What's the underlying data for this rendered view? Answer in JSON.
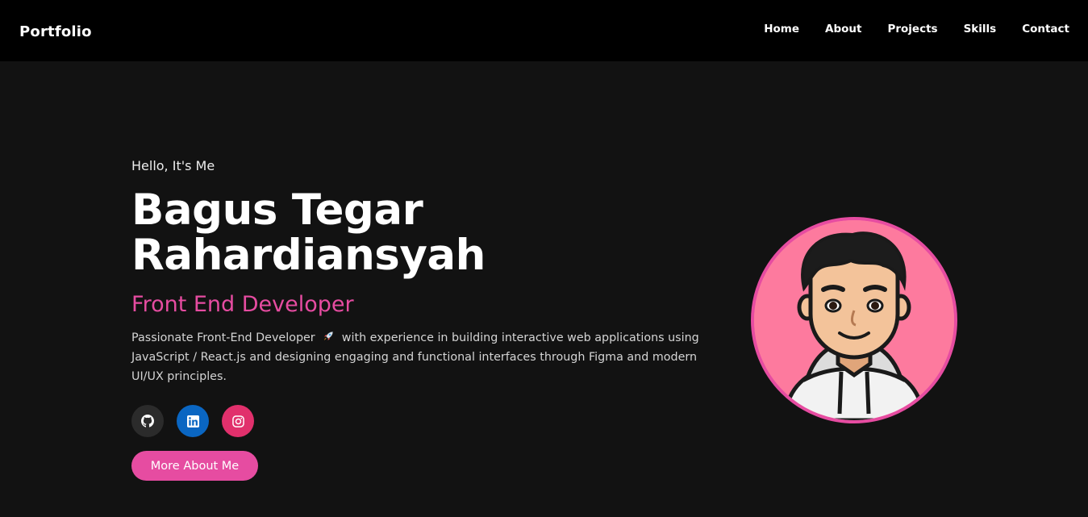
{
  "nav": {
    "logo": "Portfolio",
    "links": [
      "Home",
      "About",
      "Projects",
      "Skills",
      "Contact"
    ]
  },
  "hero": {
    "greeting": "Hello, It's Me",
    "name_line1": "Bagus Tegar",
    "name_line2": "Rahardiansyah",
    "role": "Front End Developer",
    "desc_part1": "Passionate Front-End Developer",
    "desc_part2": "with experience in building interactive web applications using JavaScript / React.js and designing engaging and functional interfaces through Figma and modern UI/UX principles.",
    "cta_label": "More About Me"
  },
  "socials": [
    {
      "name": "github-icon",
      "color": "#2b2b2b"
    },
    {
      "name": "linkedin-icon",
      "color": "#0a66c2"
    },
    {
      "name": "instagram-icon",
      "color": "#e1306c"
    }
  ],
  "colors": {
    "accent": "#e64ca1",
    "background": "#121212",
    "navbar": "#000000",
    "avatar_bg": "#fd7a9e"
  }
}
